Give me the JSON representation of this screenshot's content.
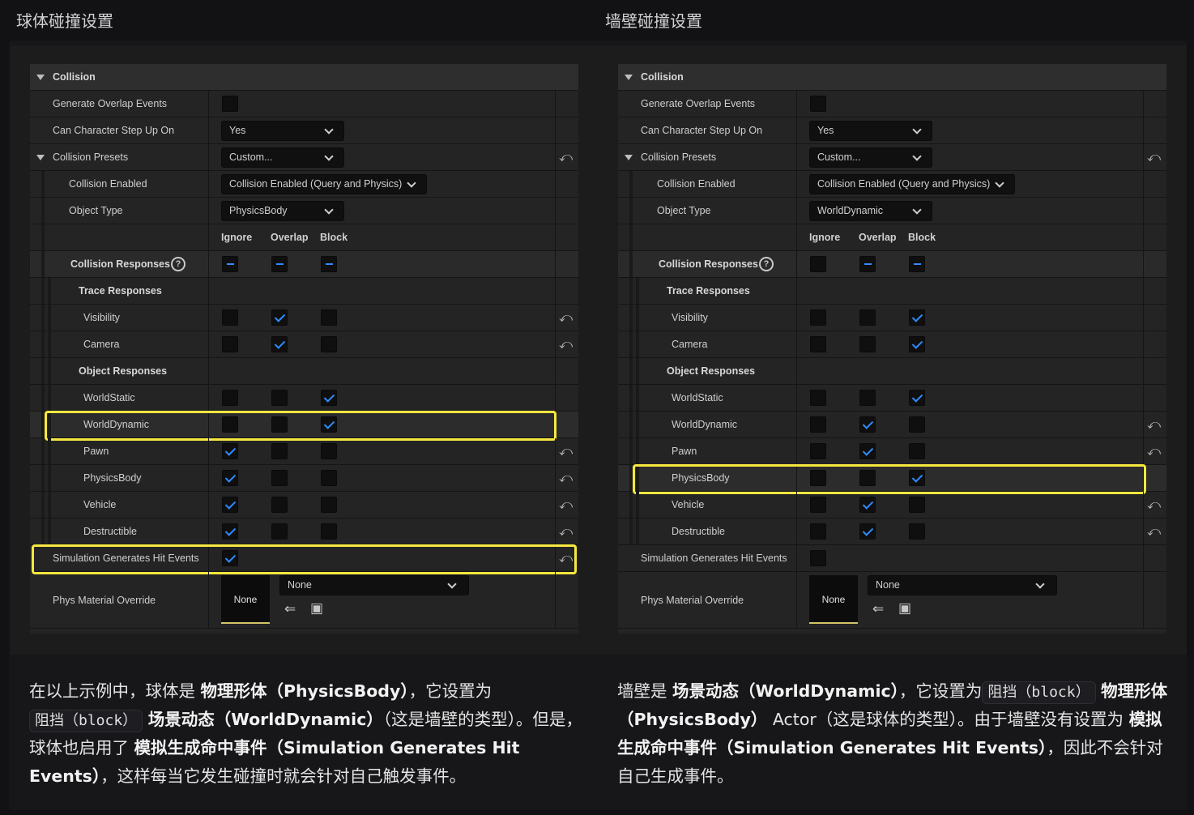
{
  "left_heading": "球体碰撞设置",
  "right_heading": "墙壁碰撞设置",
  "panels": [
    {
      "collision_header": "Collision",
      "generate_overlap": {
        "label": "Generate Overlap Events",
        "checked": false
      },
      "step_up": {
        "label": "Can Character Step Up On",
        "value": "Yes"
      },
      "presets": {
        "label": "Collision Presets",
        "value": "Custom..."
      },
      "enabled": {
        "label": "Collision Enabled",
        "value": "Collision Enabled (Query and Physics)"
      },
      "object_type": {
        "label": "Object Type",
        "value": "PhysicsBody"
      },
      "columns": [
        "Ignore",
        "Overlap",
        "Block"
      ],
      "responses_label": "Collision Responses",
      "responses_state": [
        "mixed",
        "mixed",
        "mixed"
      ],
      "trace_label": "Trace Responses",
      "trace": [
        {
          "name": "Visibility",
          "state": [
            false,
            true,
            false
          ],
          "reset": true
        },
        {
          "name": "Camera",
          "state": [
            false,
            true,
            false
          ],
          "reset": true
        }
      ],
      "object_label": "Object Responses",
      "objects": [
        {
          "name": "WorldStatic",
          "state": [
            false,
            false,
            true
          ],
          "reset": false
        },
        {
          "name": "WorldDynamic",
          "state": [
            false,
            false,
            true
          ],
          "reset": false,
          "highlight": true
        },
        {
          "name": "Pawn",
          "state": [
            true,
            false,
            false
          ],
          "reset": true
        },
        {
          "name": "PhysicsBody",
          "state": [
            true,
            false,
            false
          ],
          "reset": true
        },
        {
          "name": "Vehicle",
          "state": [
            true,
            false,
            false
          ],
          "reset": true
        },
        {
          "name": "Destructible",
          "state": [
            true,
            false,
            false
          ],
          "reset": true
        }
      ],
      "sim_hit": {
        "label": "Simulation Generates Hit Events",
        "checked": true,
        "reset": true,
        "highlight": true
      },
      "phys_material": {
        "label": "Phys Material Override",
        "thumb": "None",
        "value": "None"
      }
    },
    {
      "collision_header": "Collision",
      "generate_overlap": {
        "label": "Generate Overlap Events",
        "checked": false
      },
      "step_up": {
        "label": "Can Character Step Up On",
        "value": "Yes"
      },
      "presets": {
        "label": "Collision Presets",
        "value": "Custom..."
      },
      "enabled": {
        "label": "Collision Enabled",
        "value": "Collision Enabled (Query and Physics)"
      },
      "object_type": {
        "label": "Object Type",
        "value": "WorldDynamic"
      },
      "columns": [
        "Ignore",
        "Overlap",
        "Block"
      ],
      "responses_label": "Collision Responses",
      "responses_state": [
        "none",
        "mixed",
        "mixed"
      ],
      "trace_label": "Trace Responses",
      "trace": [
        {
          "name": "Visibility",
          "state": [
            false,
            false,
            true
          ],
          "reset": false
        },
        {
          "name": "Camera",
          "state": [
            false,
            false,
            true
          ],
          "reset": false
        }
      ],
      "object_label": "Object Responses",
      "objects": [
        {
          "name": "WorldStatic",
          "state": [
            false,
            false,
            true
          ],
          "reset": false
        },
        {
          "name": "WorldDynamic",
          "state": [
            false,
            true,
            false
          ],
          "reset": true
        },
        {
          "name": "Pawn",
          "state": [
            false,
            true,
            false
          ],
          "reset": true
        },
        {
          "name": "PhysicsBody",
          "state": [
            false,
            false,
            true
          ],
          "reset": false,
          "highlight": true
        },
        {
          "name": "Vehicle",
          "state": [
            false,
            true,
            false
          ],
          "reset": true
        },
        {
          "name": "Destructible",
          "state": [
            false,
            true,
            false
          ],
          "reset": true
        }
      ],
      "sim_hit": {
        "label": "Simulation Generates Hit Events",
        "checked": false,
        "reset": false,
        "highlight": false
      },
      "phys_material": {
        "label": "Phys Material Override",
        "thumb": "None",
        "value": "None"
      }
    }
  ],
  "left_desc": {
    "p1": "在以上示例中，球体是 ",
    "b1": "物理形体（PhysicsBody）",
    "p2": "，它设置为",
    "code": "阻挡（block）",
    "b2": "场景动态（WorldDynamic）",
    "p3": "（这是墙壁的类型）。但是，球体也启用了 ",
    "b3": "模拟生成命中事件（Simulation Generates Hit Events）",
    "p4": "，这样每当它发生碰撞时就会针对自己触发事件。"
  },
  "right_desc": {
    "p1": "墙壁是 ",
    "b1": "场景动态（WorldDynamic）",
    "p2": "，它设置为",
    "code": "阻挡（block）",
    "b2": "物理形体（PhysicsBody）",
    "p3": "Actor（这是球体的类型）。由于墙壁没有设置为 ",
    "b3": "模拟生成命中事件（Simulation Generates Hit Events）",
    "p4": "，因此不会针对自己生成事件。"
  },
  "colors": {
    "highlight": "#f5e73f",
    "check": "#2f8cff"
  }
}
